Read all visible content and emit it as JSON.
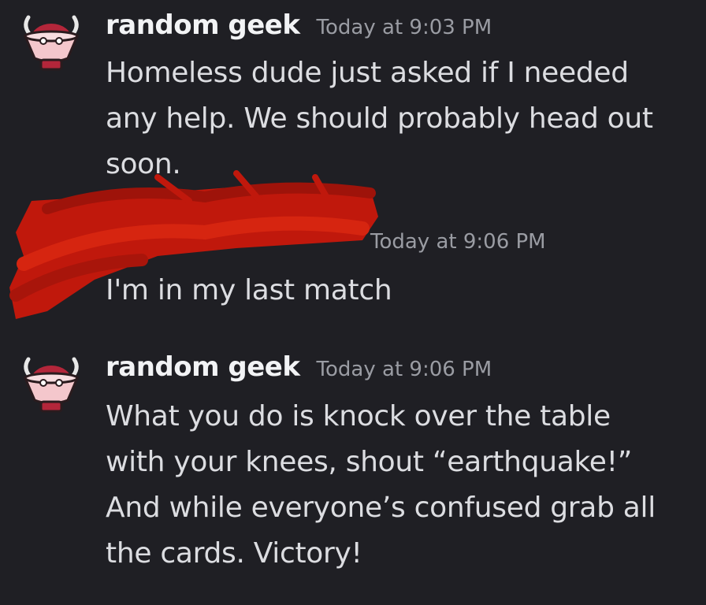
{
  "colors": {
    "background": "#1f1f24",
    "username": "#f2f3f5",
    "message_text": "#dcdde1",
    "timestamp": "#9a9ca3",
    "redaction_red": "#c0180c"
  },
  "messages": [
    {
      "username": "random geek",
      "timestamp": "Today at 9:03 PM",
      "avatar_icon": "devil-in-bowl-icon",
      "lines": [
        "Homeless dude just asked if I needed",
        "any help. We should probably head out",
        "soon."
      ]
    },
    {
      "username": "",
      "timestamp": "Today at 9:06 PM",
      "redacted": true,
      "lines": [
        "I'm in my last match"
      ]
    },
    {
      "username": "random geek",
      "timestamp": "Today at 9:06 PM",
      "avatar_icon": "devil-in-bowl-icon",
      "lines": [
        "What you do is knock over the table",
        "with your knees, shout “earthquake!”",
        "And while everyone’s confused grab all",
        "the cards. Victory!"
      ]
    }
  ]
}
